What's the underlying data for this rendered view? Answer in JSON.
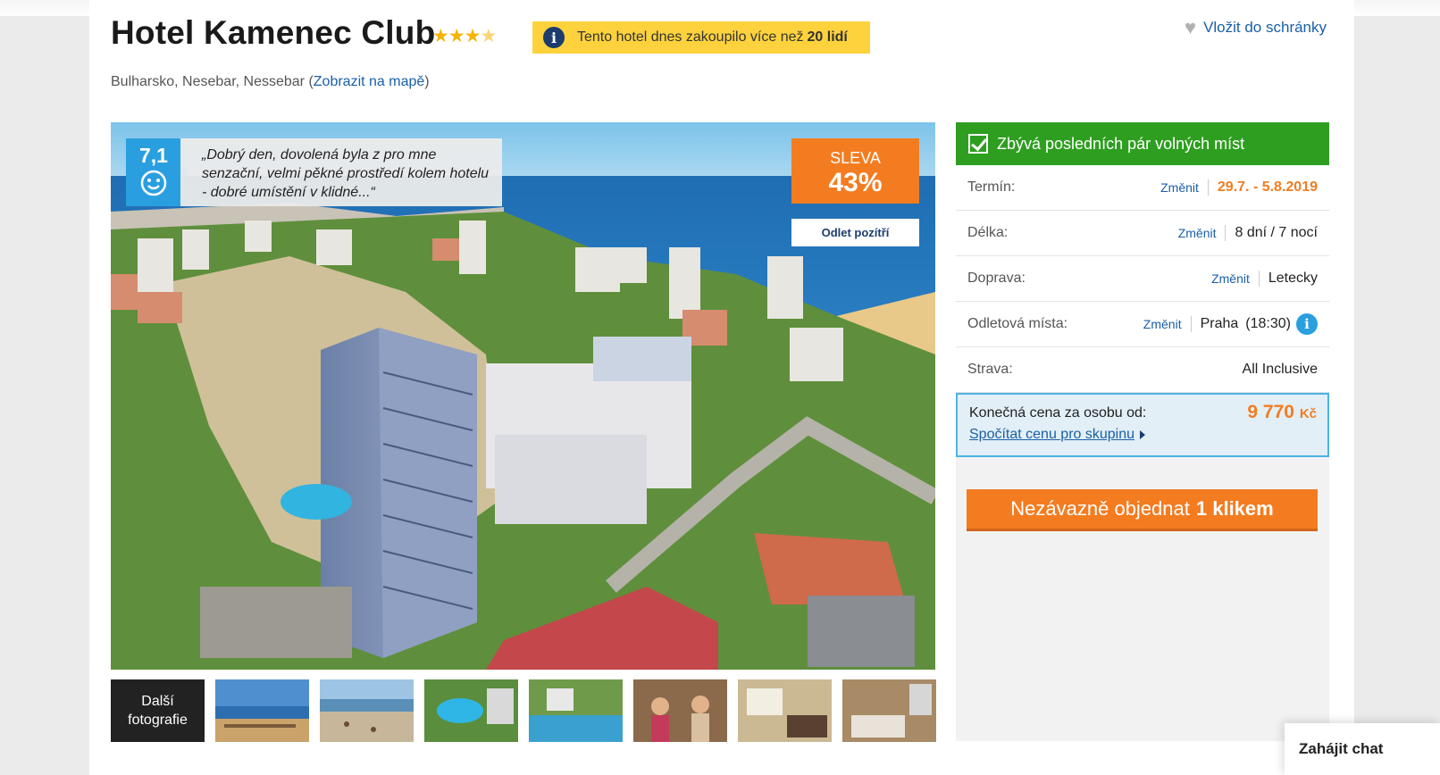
{
  "hotel": {
    "name": "Hotel Kamenec Club",
    "stars": "★★★",
    "half_star": "★",
    "location_prefix": "Bulharsko, Nesebar, Nessebar (",
    "map_link": "Zobrazit na mapě",
    "location_suffix": ")"
  },
  "notice": {
    "text": "Tento hotel dnes zakoupilo více než",
    "count": "20 lidí"
  },
  "favorite": {
    "label": "Vložit do schránky"
  },
  "photo": {
    "rating": "7,1",
    "review_quote": "„Dobrý den, dovolená byla z pro mne senzační, velmi pěkné prostředí kolem hotelu - dobré umístění v klidné...“",
    "discount_label": "SLEVA",
    "discount_value": "43%",
    "odlet_badge": "Odlet pozítří"
  },
  "thumbnails": {
    "more_label_1": "Další",
    "more_label_2": "fotografie"
  },
  "booking": {
    "availability": "Zbývá posledních pár volných míst",
    "rows": [
      {
        "label": "Termín:",
        "change": "Změnit",
        "value": "29.7. - 5.8.2019"
      },
      {
        "label": "Délka:",
        "change": "Změnit",
        "value": "8 dní / 7 nocí"
      },
      {
        "label": "Doprava:",
        "change": "Změnit",
        "value": "Letecky"
      },
      {
        "label": "Odletová místa:",
        "change": "Změnit",
        "value": "Praha",
        "time": "(18:30)"
      },
      {
        "label": "Strava:",
        "value": "All Inclusive"
      }
    ],
    "price_label": "Konečná cena za osobu od:",
    "price_value": "9 770",
    "price_currency": "Kč",
    "group_link": "Spočítat cenu pro skupinu",
    "order_text": "Nezávazně objednat",
    "order_bold": "1 klikem"
  },
  "chat": {
    "label": "Zahájit chat"
  },
  "colors": {
    "accent": "#f47c20",
    "available": "#2e9e20",
    "link": "#1a5fa8",
    "rating": "#2a9fe0",
    "notice": "#fdd23c"
  }
}
